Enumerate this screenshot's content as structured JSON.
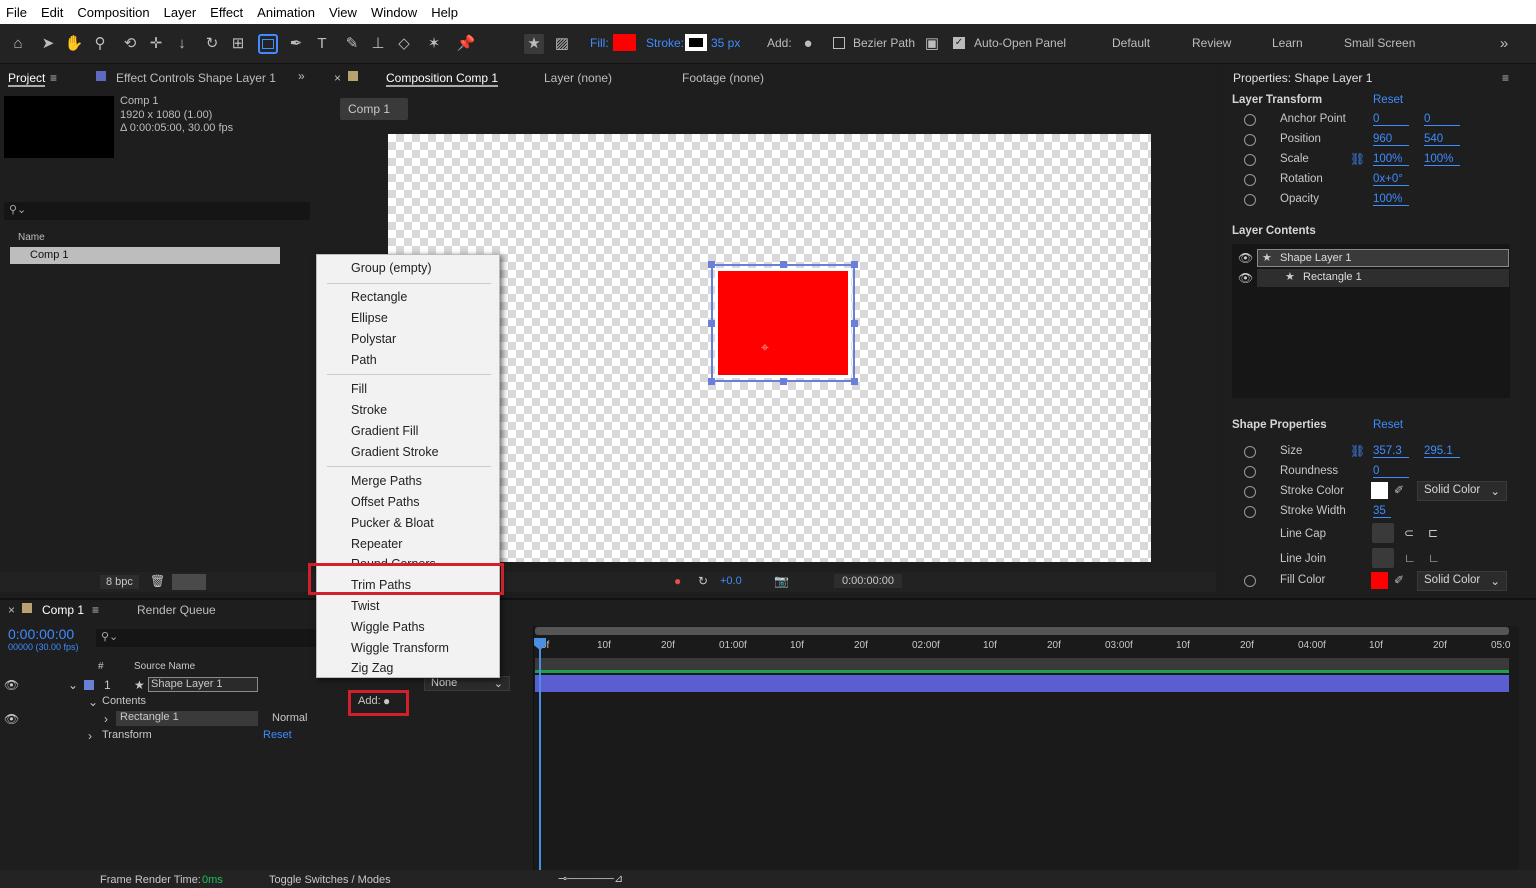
{
  "menu": [
    "File",
    "Edit",
    "Composition",
    "Layer",
    "Effect",
    "Animation",
    "View",
    "Window",
    "Help"
  ],
  "toolbar": {
    "fill_label": "Fill:",
    "stroke_label": "Stroke:",
    "stroke_width": "35 px",
    "add_label": "Add:",
    "bezier_label": "Bezier Path",
    "auto_open_label": "Auto-Open Panel",
    "workspaces": [
      "Default",
      "Review",
      "Learn",
      "Small Screen"
    ],
    "fill_color": "#ff0000"
  },
  "project": {
    "tab_project": "Project",
    "tab_effect": "Effect Controls Shape Layer 1",
    "comp_name": "Comp 1",
    "comp_res": "1920 x 1080 (1.00)",
    "comp_dur": "Δ 0:00:05:00, 30.00 fps",
    "col_name": "Name",
    "item": "Comp 1",
    "bpc": "8 bpc"
  },
  "viewer": {
    "tab_comp": "Composition Comp 1",
    "tab_layer": "Layer (none)",
    "tab_footage": "Footage (none)",
    "breadcrumb": "Comp 1",
    "exposure": "+0.0",
    "timecode": "0:00:00:00"
  },
  "dropdown": {
    "items_g1": [
      "Group (empty)"
    ],
    "items_g2": [
      "Rectangle",
      "Ellipse",
      "Polystar",
      "Path"
    ],
    "items_g3": [
      "Fill",
      "Stroke",
      "Gradient Fill",
      "Gradient Stroke"
    ],
    "items_g4": [
      "Merge Paths",
      "Offset Paths",
      "Pucker & Bloat",
      "Repeater",
      "Round Corners",
      "Trim Paths",
      "Twist",
      "Wiggle Paths",
      "Wiggle Transform",
      "Zig Zag"
    ]
  },
  "properties": {
    "title": "Properties: Shape Layer 1",
    "layer_transform": "Layer Transform",
    "reset": "Reset",
    "anchor_label": "Anchor Point",
    "anchor_x": "0",
    "anchor_y": "0",
    "position_label": "Position",
    "position_x": "960",
    "position_y": "540",
    "scale_label": "Scale",
    "scale_x": "100%",
    "scale_y": "100%",
    "rotation_label": "Rotation",
    "rotation_val": "0x+0°",
    "opacity_label": "Opacity",
    "opacity_val": "100%",
    "layer_contents": "Layer Contents",
    "content_layer": "Shape Layer 1",
    "content_rect": "Rectangle 1",
    "shape_props": "Shape Properties",
    "size_label": "Size",
    "size_w": "357.3",
    "size_h": "295.1",
    "roundness_label": "Roundness",
    "roundness_val": "0",
    "stroke_color_label": "Stroke Color",
    "stroke_color_mode": "Solid Color",
    "stroke_width_label": "Stroke Width",
    "stroke_width_val": "35",
    "line_cap_label": "Line Cap",
    "line_join_label": "Line Join",
    "fill_color_label": "Fill Color",
    "fill_color_mode": "Solid Color"
  },
  "timeline": {
    "tab_comp": "Comp 1",
    "tab_render": "Render Queue",
    "timecode": "0:00:00:00",
    "frame_sub": "00000 (30.00 fps)",
    "col_source": "Source Name",
    "layer_num": "1",
    "layer_name": "Shape Layer 1",
    "parent_none": "None",
    "contents": "Contents",
    "add_label": "Add:",
    "rect": "Rectangle 1",
    "blend": "Normal",
    "transform": "Transform",
    "reset": "Reset",
    "ruler": [
      "0f",
      "10f",
      "20f",
      "01:00f",
      "10f",
      "20f",
      "02:00f",
      "10f",
      "20f",
      "03:00f",
      "10f",
      "20f",
      "04:00f",
      "10f",
      "20f",
      "05:0"
    ],
    "frame_render_label": "Frame Render Time:",
    "frame_render_val": "0ms",
    "toggle_label": "Toggle Switches / Modes"
  }
}
